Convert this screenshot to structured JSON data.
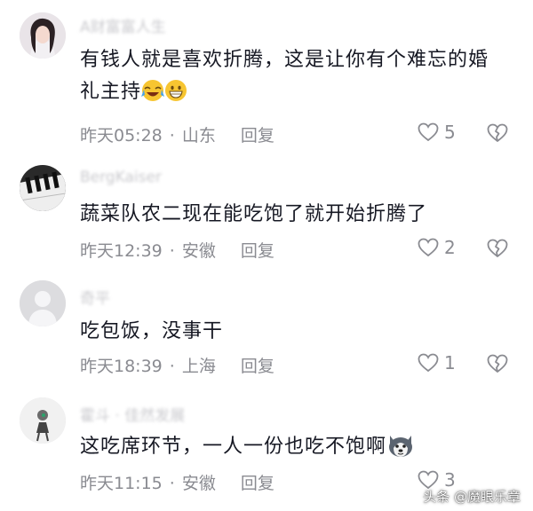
{
  "comments": [
    {
      "username": "A财富富人生",
      "avatar": "woman-portrait-avatar",
      "text": "有钱人就是喜欢折腾，这是让你有个难忘的婚礼主持",
      "emojis": [
        "laughing-tears-emoji",
        "grinning-face-emoji"
      ],
      "time": "昨天05:28",
      "location": "山东",
      "reply_label": "回复",
      "likes": "5"
    },
    {
      "username": "BergKaiser",
      "avatar": "piano-keys-avatar",
      "text": "蔬菜队农二现在能吃饱了就开始折腾了",
      "emojis": [],
      "time": "昨天12:39",
      "location": "安徽",
      "reply_label": "回复",
      "likes": "2"
    },
    {
      "username": "奇平",
      "avatar": "default-gray-avatar",
      "text": "吃包饭，没事干",
      "emojis": [],
      "time": "昨天18:39",
      "location": "上海",
      "reply_label": "回复",
      "likes": "1"
    },
    {
      "username": "霍斗 · 佳然发展",
      "avatar": "figure-avatar",
      "text": "这吃席环节，一人一份也吃不饱啊",
      "emojis": [
        "husky-emoji"
      ],
      "time": "昨天11:15",
      "location": "安徽",
      "reply_label": "回复",
      "likes": "3"
    }
  ],
  "watermark": "头条 @魔眼乐章",
  "colors": {
    "text": "#161823",
    "meta": "#8a8b91",
    "username": "#c9c9cd",
    "background": "#ffffff"
  }
}
